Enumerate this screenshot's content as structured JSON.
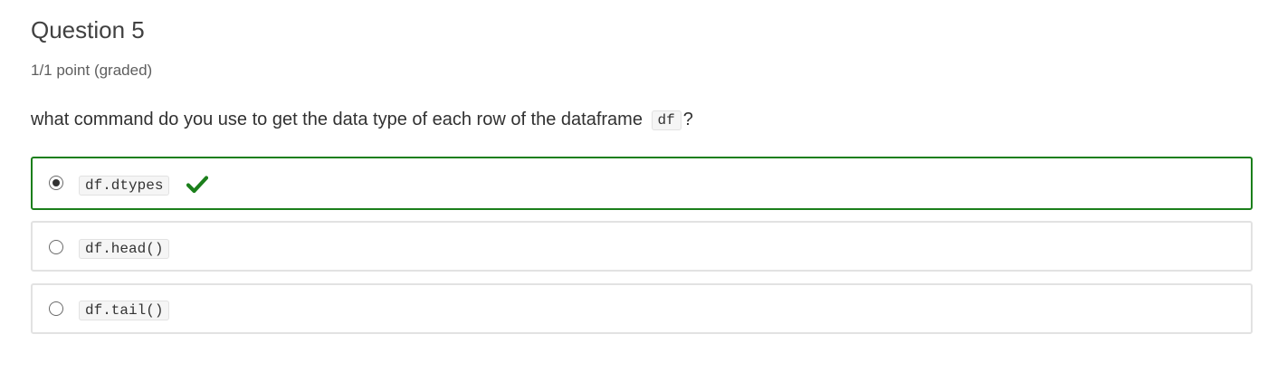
{
  "question": {
    "title": "Question 5",
    "points": "1/1 point (graded)",
    "prompt_text": "what command do you use to get the data type of each row of the dataframe",
    "prompt_code": "df",
    "prompt_suffix": "?"
  },
  "choices": [
    {
      "label": "df.dtypes",
      "selected": true,
      "correct": true
    },
    {
      "label": "df.head()",
      "selected": false,
      "correct": false
    },
    {
      "label": "df.tail()",
      "selected": false,
      "correct": false
    }
  ],
  "colors": {
    "correct_border": "#1b7f1b",
    "checkmark": "#1b7f1b",
    "default_border": "#e2e2e2"
  },
  "icons": {
    "correct_indicator": "checkmark-icon"
  }
}
